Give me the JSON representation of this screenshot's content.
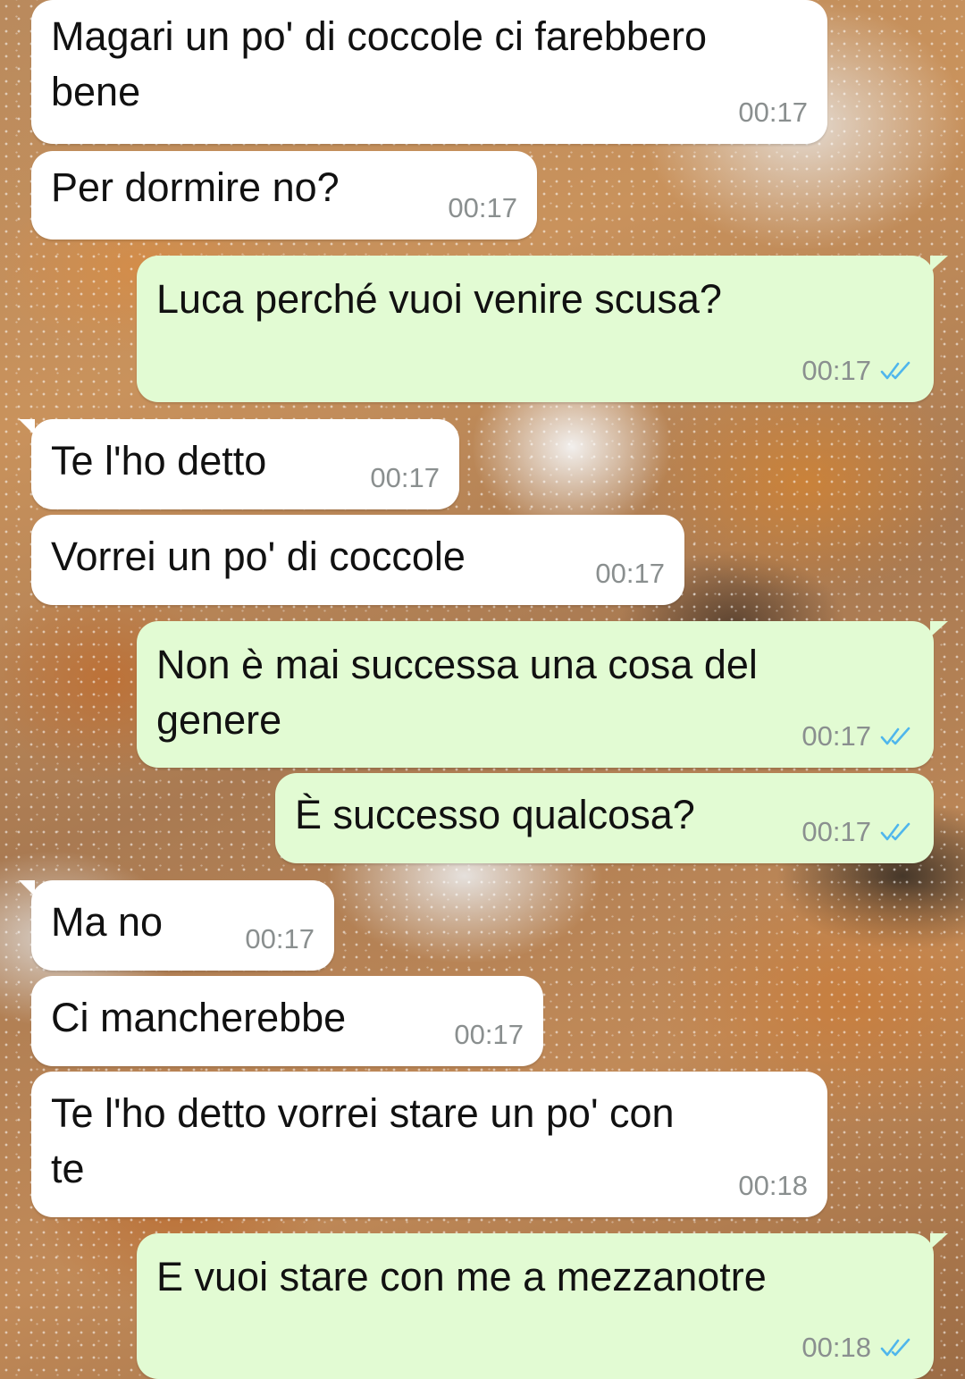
{
  "chat": {
    "messages": [
      {
        "direction": "incoming",
        "text_lines": [
          "Magari un po' di coccole ci farebbero",
          "bene"
        ],
        "time": "00:17"
      },
      {
        "direction": "incoming",
        "text_lines": [
          "Per dormire no?"
        ],
        "time": "00:17"
      },
      {
        "direction": "outgoing",
        "text_lines": [
          "Luca perché vuoi venire scusa?"
        ],
        "time": "00:17",
        "status_icon": "double-check-icon"
      },
      {
        "direction": "incoming",
        "text_lines": [
          "Te l'ho detto"
        ],
        "time": "00:17"
      },
      {
        "direction": "incoming",
        "text_lines": [
          "Vorrei un po' di coccole"
        ],
        "time": "00:17"
      },
      {
        "direction": "outgoing",
        "text_lines": [
          "Non è mai successa una cosa del",
          "genere"
        ],
        "time": "00:17",
        "status_icon": "double-check-icon"
      },
      {
        "direction": "outgoing",
        "text_lines": [
          "È successo qualcosa?"
        ],
        "time": "00:17",
        "status_icon": "double-check-icon"
      },
      {
        "direction": "incoming",
        "text_lines": [
          "Ma no"
        ],
        "time": "00:17"
      },
      {
        "direction": "incoming",
        "text_lines": [
          "Ci mancherebbe"
        ],
        "time": "00:17"
      },
      {
        "direction": "incoming",
        "text_lines": [
          "Te l'ho detto vorrei stare un po' con",
          "te"
        ],
        "time": "00:18"
      },
      {
        "direction": "outgoing",
        "text_lines": [
          "E vuoi stare con me a mezzanotre"
        ],
        "time": "00:18",
        "status_icon": "double-check-icon"
      }
    ]
  },
  "colors": {
    "incoming_bubble": "#ffffff",
    "outgoing_bubble": "#e2fbd3",
    "read_check": "#4fb6ec",
    "timestamp": "#8a8f8f",
    "text": "#111111"
  }
}
